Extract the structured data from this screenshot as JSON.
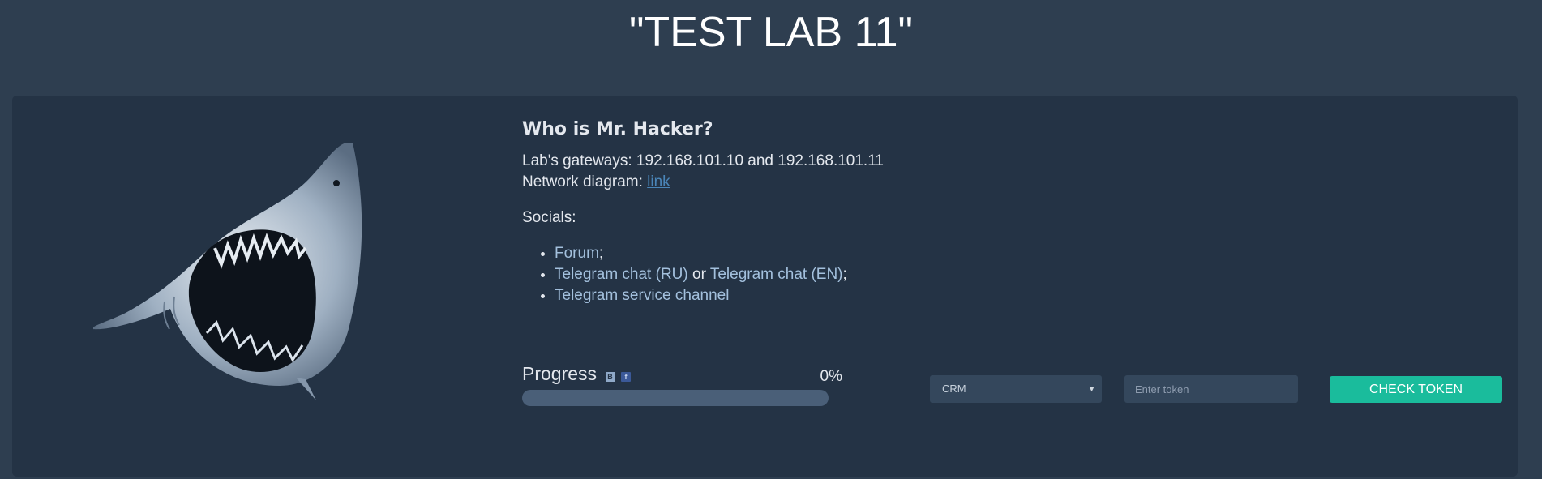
{
  "page": {
    "title": "\"TEST LAB 11\""
  },
  "lab": {
    "heading": "Who is Mr. Hacker?",
    "gateways_text": "Lab's gateways: 192.168.101.10 and 192.168.101.11",
    "diagram_label": "Network diagram:",
    "diagram_link": "link",
    "socials_label": "Socials:",
    "socials": {
      "forum": "Forum",
      "forum_suffix": ";",
      "telegram_ru": "Telegram chat (RU)",
      "or_text": "or",
      "telegram_en": "Telegram chat (EN)",
      "telegram_en_suffix": ";",
      "service_channel": "Telegram service channel"
    }
  },
  "progress": {
    "label": "Progress",
    "vk_icon": "vk-icon",
    "vk_glyph": "B",
    "fb_icon": "facebook-icon",
    "fb_glyph": "f",
    "percent_text": "0%",
    "value": 0
  },
  "token_form": {
    "selected_lab": "CRM",
    "input_placeholder": "Enter token",
    "button_label": "CHECK TOKEN"
  },
  "colors": {
    "page_bg": "#2e3e50",
    "panel_bg": "#243345",
    "accent": "#1abc9c",
    "link": "#4a85b8"
  }
}
